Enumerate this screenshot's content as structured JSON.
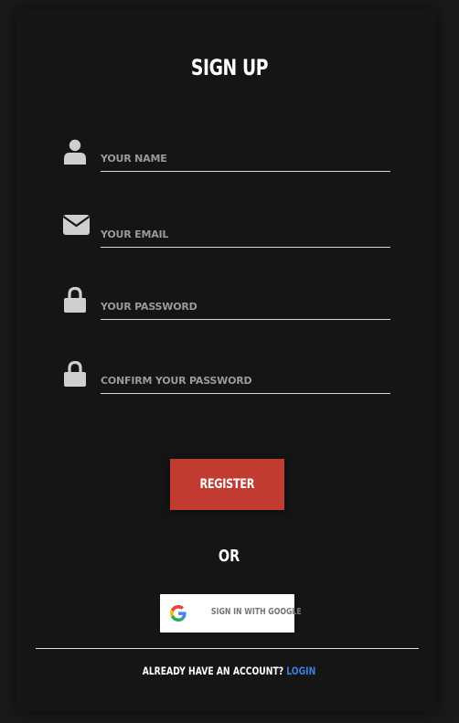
{
  "form": {
    "title": "SIGN UP",
    "fields": [
      {
        "icon": "user-icon",
        "placeholder": "YOUR NAME",
        "value": ""
      },
      {
        "icon": "envelope-icon",
        "placeholder": "YOUR EMAIL",
        "value": ""
      },
      {
        "icon": "lock-icon",
        "placeholder": "YOUR PASSWORD",
        "value": ""
      },
      {
        "icon": "lock-icon",
        "placeholder": "CONFIRM YOUR PASSWORD",
        "value": ""
      }
    ],
    "register_label": "REGISTER",
    "or_label": "OR",
    "google_label": "SIGN IN WITH GOOGLE",
    "footer_question": "ALREADY HAVE AN ACCOUNT?",
    "footer_link": "LOGIN"
  },
  "colors": {
    "background": "#151515",
    "accent": "#c23b31",
    "link": "#3f7be0",
    "icon": "#cfcfcf"
  }
}
